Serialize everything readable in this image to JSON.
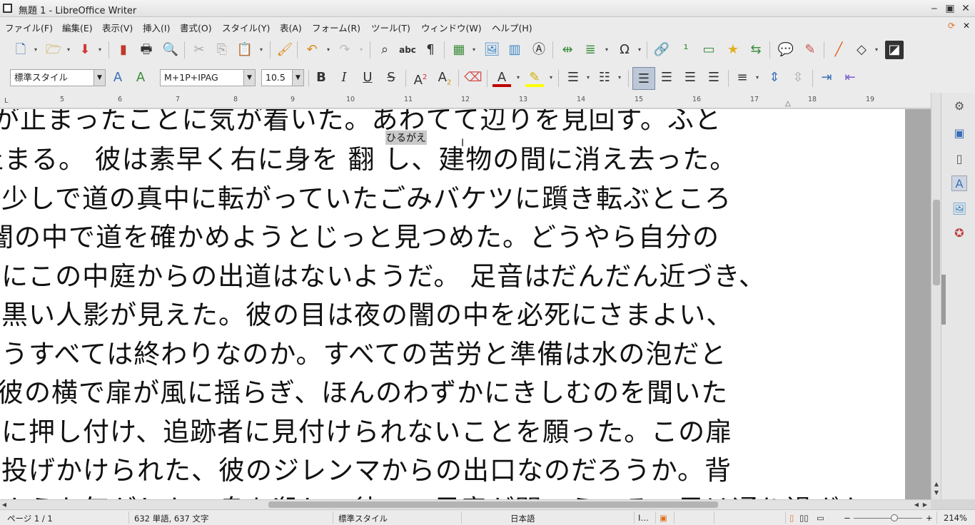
{
  "window": {
    "title": "無題 1 - LibreOffice Writer"
  },
  "menu": {
    "items": [
      "ファイル(F)",
      "編集(E)",
      "表示(V)",
      "挿入(I)",
      "書式(O)",
      "スタイル(Y)",
      "表(A)",
      "フォーム(R)",
      "ツール(T)",
      "ウィンドウ(W)",
      "ヘルプ(H)"
    ]
  },
  "formatting": {
    "paragraph_style": "標準スタイル",
    "font_name": "M+1P+IPAG",
    "font_size": "10.5",
    "bold": "B",
    "italic": "I",
    "underline": "U",
    "strike": "S"
  },
  "ruler": {
    "numbers": [
      "5",
      "6",
      "7",
      "8",
      "9",
      "10",
      "11",
      "12",
      "13",
      "14",
      "15",
      "16",
      "17",
      "18",
      "19"
    ]
  },
  "document": {
    "ruby": "ひるがえ",
    "lines": [
      "が止まったことに気が着いた。あわてて辺りを見回す。ふと",
      "止まる。 彼は素早く右に身を 翻 し、建物の間に消え去った。",
      "少しで道の真中に転がっていたごみバケツに躓き転ぶところ",
      "闇の中で道を確かめようとじっと見つめた。どうやら自分の",
      "にこの中庭からの出道はないようだ。 足音はだんだん近づき、",
      "黒い人影が見えた。彼の目は夜の闇の中を必死にさまよい、",
      "うすべては終わりなのか。すべての苦労と準備は水の泡だと",
      " 彼の横で扉が風に揺らぎ、ほんのわずかにきしむのを聞いた",
      "に押し付け、追跡者に見付けられないことを願った。この扉",
      "投げかけられた、彼のジレンマからの出口なのだろうか。背",
      "ような気がした。息を殺して待つ。足音が聞こえ、その男は通り過ぎた"
    ]
  },
  "status": {
    "page": "ページ 1 / 1",
    "words": "632 単語, 637 文字",
    "style": "標準スタイル",
    "language": "日本語",
    "zoom": "214%"
  }
}
